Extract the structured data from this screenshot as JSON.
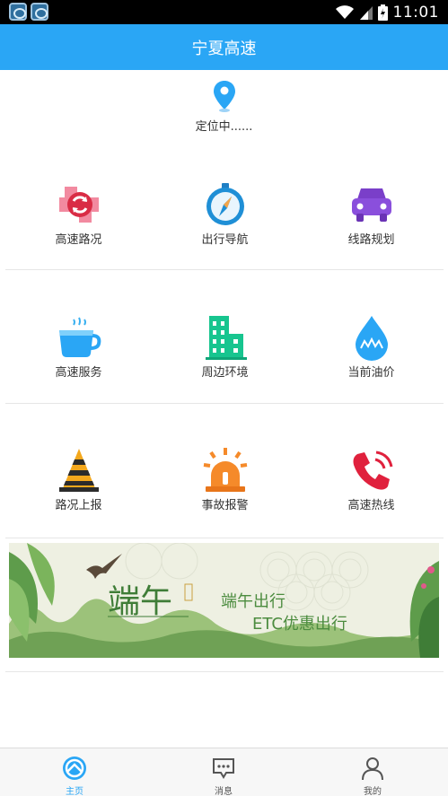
{
  "status_bar": {
    "time": "11:01"
  },
  "header": {
    "title": "宁夏高速"
  },
  "location": {
    "text": "定位中......"
  },
  "grid": {
    "rows": [
      [
        {
          "label": "高速路况",
          "icon": "road-condition-icon"
        },
        {
          "label": "出行导航",
          "icon": "compass-icon"
        },
        {
          "label": "线路规划",
          "icon": "car-icon"
        }
      ],
      [
        {
          "label": "高速服务",
          "icon": "cup-icon"
        },
        {
          "label": "周边环境",
          "icon": "buildings-icon"
        },
        {
          "label": "当前油价",
          "icon": "oil-drop-icon"
        }
      ],
      [
        {
          "label": "路况上报",
          "icon": "traffic-cone-icon"
        },
        {
          "label": "事故报警",
          "icon": "alarm-light-icon"
        },
        {
          "label": "高速热线",
          "icon": "phone-icon"
        }
      ]
    ]
  },
  "banner": {
    "title": "端午",
    "line1": "端午出行",
    "line2": "ETC优惠出行"
  },
  "bottom_nav": [
    {
      "label": "主页",
      "icon": "home-steering-icon",
      "active": true
    },
    {
      "label": "消息",
      "icon": "message-icon",
      "active": false
    },
    {
      "label": "我的",
      "icon": "user-icon",
      "active": false
    }
  ],
  "colors": {
    "accent": "#2aa6f5",
    "inactive": "#555555"
  }
}
